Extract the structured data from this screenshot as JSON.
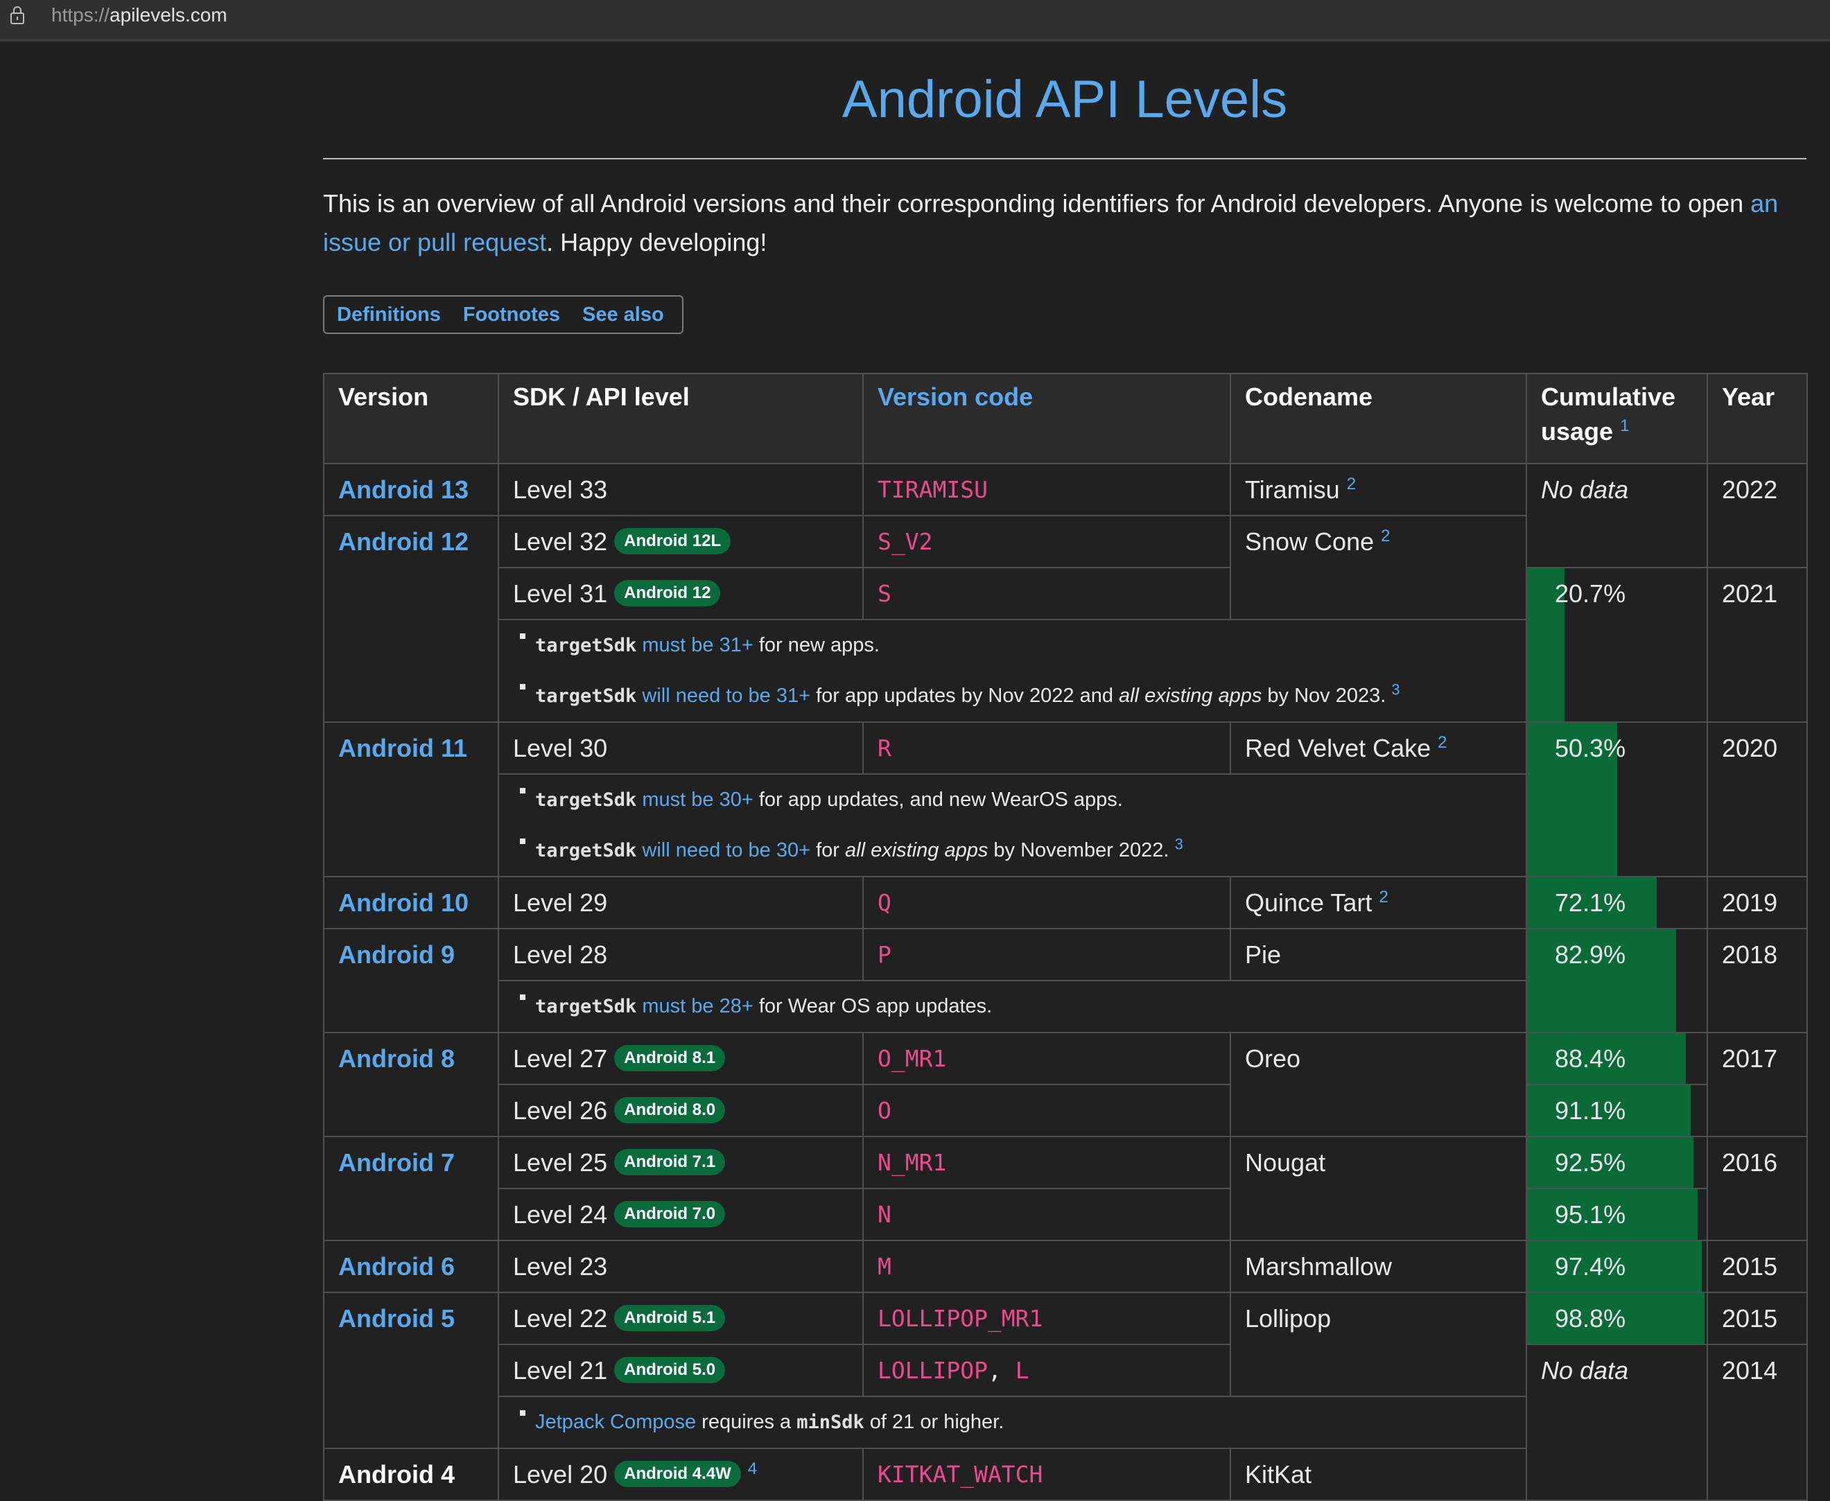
{
  "browser": {
    "url_scheme": "https://",
    "url_host": "apilevels.com"
  },
  "page": {
    "title": "Android API Levels",
    "intro_text": "This is an overview of all Android versions and their corresponding identifiers for Android developers. Anyone is welcome to open ",
    "intro_link": "an issue or pull request",
    "intro_end": ". Happy developing!"
  },
  "nav": {
    "definitions": "Definitions",
    "footnotes": "Footnotes",
    "see_also": "See also"
  },
  "table": {
    "headers": {
      "version": "Version",
      "sdk": "SDK / API level",
      "code": "Version code",
      "codename": "Codename",
      "usage": "Cumulative usage",
      "usage_sup": "1",
      "year": "Year"
    },
    "rows": {
      "a13": {
        "version": "Android 13",
        "level": "Level 33",
        "code": "TIRAMISU",
        "codename": "Tiramisu",
        "sup": "2",
        "usage": "No data",
        "year": "2022"
      },
      "a12": {
        "version": "Android 12",
        "level": "Level 32",
        "badge": "Android 12L",
        "code": "S_V2",
        "codename": "Snow Cone",
        "sup": "2",
        "level2": "Level 31",
        "badge2": "Android 12",
        "code2": "S",
        "usage": "20.7%",
        "usage_value": 20.7,
        "year": "2021",
        "note1_code": "targetSdk",
        "note1_link": "must be 31+",
        "note1_text": " for new apps.",
        "note2_code": "targetSdk",
        "note2_link": "will need to be 31+",
        "note2_text1": " for app updates by Nov 2022 and ",
        "note2_em": "all existing apps",
        "note2_text2": " by Nov 2023.",
        "note2_sup": "3"
      },
      "a11": {
        "version": "Android 11",
        "level": "Level 30",
        "code": "R",
        "codename": "Red Velvet Cake",
        "sup": "2",
        "usage": "50.3%",
        "usage_value": 50.3,
        "year": "2020",
        "note1_code": "targetSdk",
        "note1_link": "must be 30+",
        "note1_text": " for app updates, and new WearOS apps.",
        "note2_code": "targetSdk",
        "note2_link": "will need to be 30+",
        "note2_text1": " for ",
        "note2_em": "all existing apps",
        "note2_text2": " by November 2022.",
        "note2_sup": "3"
      },
      "a10": {
        "version": "Android 10",
        "level": "Level 29",
        "code": "Q",
        "codename": "Quince Tart",
        "sup": "2",
        "usage": "72.1%",
        "usage_value": 72.1,
        "year": "2019"
      },
      "a9": {
        "version": "Android 9",
        "level": "Level 28",
        "code": "P",
        "codename": "Pie",
        "usage": "82.9%",
        "usage_value": 82.9,
        "year": "2018",
        "note1_code": "targetSdk",
        "note1_link": "must be 28+",
        "note1_text": " for Wear OS app updates."
      },
      "a8": {
        "version": "Android 8",
        "level": "Level 27",
        "badge": "Android 8.1",
        "code": "O_MR1",
        "codename": "Oreo",
        "usage": "88.4%",
        "usage_value": 88.4,
        "year": "2017",
        "level2": "Level 26",
        "badge2": "Android 8.0",
        "code2": "O",
        "usage2": "91.1%",
        "usage2_value": 91.1
      },
      "a7": {
        "version": "Android 7",
        "level": "Level 25",
        "badge": "Android 7.1",
        "code": "N_MR1",
        "codename": "Nougat",
        "usage": "92.5%",
        "usage_value": 92.5,
        "year": "2016",
        "level2": "Level 24",
        "badge2": "Android 7.0",
        "code2": "N",
        "usage2": "95.1%",
        "usage2_value": 95.1
      },
      "a6": {
        "version": "Android 6",
        "level": "Level 23",
        "code": "M",
        "codename": "Marshmallow",
        "usage": "97.4%",
        "usage_value": 97.4,
        "year": "2015"
      },
      "a5": {
        "version": "Android 5",
        "level": "Level 22",
        "badge": "Android 5.1",
        "code": "LOLLIPOP_MR1",
        "codename": "Lollipop",
        "usage": "98.8%",
        "usage_value": 98.8,
        "year": "2015",
        "level2": "Level 21",
        "badge2": "Android 5.0",
        "code2a": "LOLLIPOP",
        "comma": ",",
        "code2b": "L",
        "usage2": "No data",
        "year2": "2014",
        "note1_link": "Jetpack Compose",
        "note1_text1": " requires a ",
        "note1_code": "minSdk",
        "note1_text2": " of 21 or higher."
      },
      "a4": {
        "version": "Android 4",
        "level": "Level 20",
        "badge": "Android 4.4W",
        "badge_sup": "4",
        "code": "KITKAT_WATCH",
        "codename": "KitKat"
      }
    }
  },
  "colors": {
    "accent": "#5aa9ee",
    "code": "#ea4c8b",
    "badge": "#0c6b3c",
    "usage_bar": "#0b6b38",
    "background": "#202020"
  }
}
